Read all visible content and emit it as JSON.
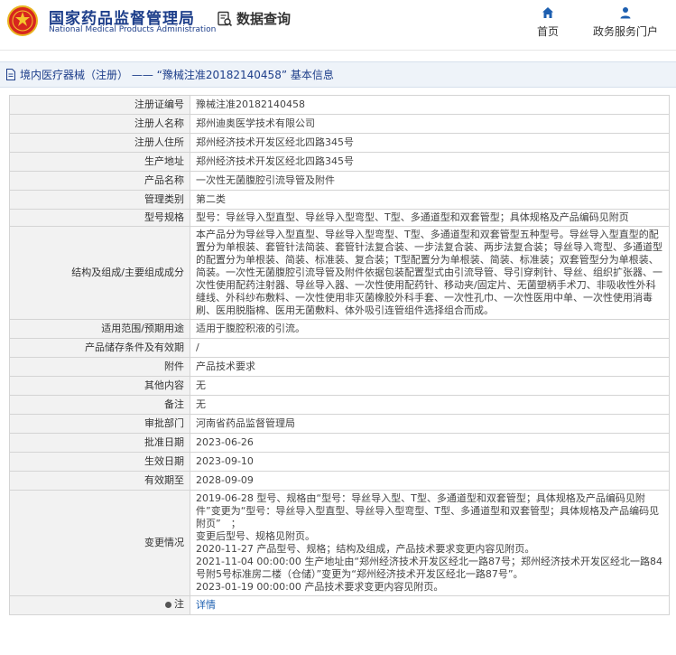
{
  "header": {
    "org_name": "国家药品监督管理局",
    "org_name_en": "National Medical Products Administration",
    "page_heading": "数据查询",
    "nav": [
      {
        "label": "首页",
        "icon": "home-icon"
      },
      {
        "label": "政务服务门户",
        "icon": "user-icon"
      }
    ]
  },
  "breadcrumb": {
    "text": "境内医疗器械（注册） —— “豫械注准20182140458” 基本信息"
  },
  "rows": [
    {
      "label": "注册证编号",
      "value": "豫械注准20182140458"
    },
    {
      "label": "注册人名称",
      "value": "郑州迪奥医学技术有限公司"
    },
    {
      "label": "注册人住所",
      "value": "郑州经济技术开发区经北四路345号"
    },
    {
      "label": "生产地址",
      "value": "郑州经济技术开发区经北四路345号"
    },
    {
      "label": "产品名称",
      "value": "一次性无菌腹腔引流导管及附件"
    },
    {
      "label": "管理类别",
      "value": "第二类"
    },
    {
      "label": "型号规格",
      "value": "型号：导丝导入型直型、导丝导入型弯型、T型、多通道型和双套管型；具体规格及产品编码见附页"
    },
    {
      "label": "结构及组成/主要组成成分",
      "value": "本产品分为导丝导入型直型、导丝导入型弯型、T型、多通道型和双套管型五种型号。导丝导入型直型的配置分为单根装、套管针法简装、套管针法复合装、一步法复合装、两步法复合装；导丝导入弯型、多通道型的配置分为单根装、简装、标准装、复合装；T型配置分为单根装、简装、标准装；双套管型分为单根装、简装。一次性无菌腹腔引流导管及附件依据包装配置型式由引流导管、导引穿刺针、导丝、组织扩张器、一次性使用配药注射器、导丝导入器、一次性使用配药针、移动夹/固定片、无菌塑柄手术刀、非吸收性外科缝线、外科纱布敷料、一次性使用非灭菌橡胶外科手套、一次性孔巾、一次性医用中单、一次性使用消毒刷、医用脱脂棉、医用无菌敷料、体外吸引连管组件选择组合而成。"
    },
    {
      "label": "适用范围/预期用途",
      "value": "适用于腹腔积液的引流。"
    },
    {
      "label": "产品储存条件及有效期",
      "value": "/"
    },
    {
      "label": "附件",
      "value": "产品技术要求"
    },
    {
      "label": "其他内容",
      "value": "无"
    },
    {
      "label": "备注",
      "value": "无"
    },
    {
      "label": "审批部门",
      "value": "河南省药品监督管理局"
    },
    {
      "label": "批准日期",
      "value": "2023-06-26"
    },
    {
      "label": "生效日期",
      "value": "2023-09-10"
    },
    {
      "label": "有效期至",
      "value": "2028-09-09"
    },
    {
      "label": "变更情况",
      "value": "2019-06-28 型号、规格由“型号：导丝导入型、T型、多通道型和双套管型；具体规格及产品编码见附件”变更为“型号：导丝导入型直型、导丝导入型弯型、T型、多通道型和双套管型；具体规格及产品编码见附页”　；\n变更后型号、规格见附页。\n2020-11-27 产品型号、规格；结构及组成，产品技术要求变更内容见附页。\n2021-11-04 00:00:00 生产地址由“郑州经济技术开发区经北一路87号；郑州经济技术开发区经北一路84号附5号标准房二楼（仓储）”变更为“郑州经济技术开发区经北一路87号”。\n2023-01-19 00:00:00 产品技术要求变更内容见附页。"
    },
    {
      "label": "注",
      "value": "详情"
    }
  ]
}
